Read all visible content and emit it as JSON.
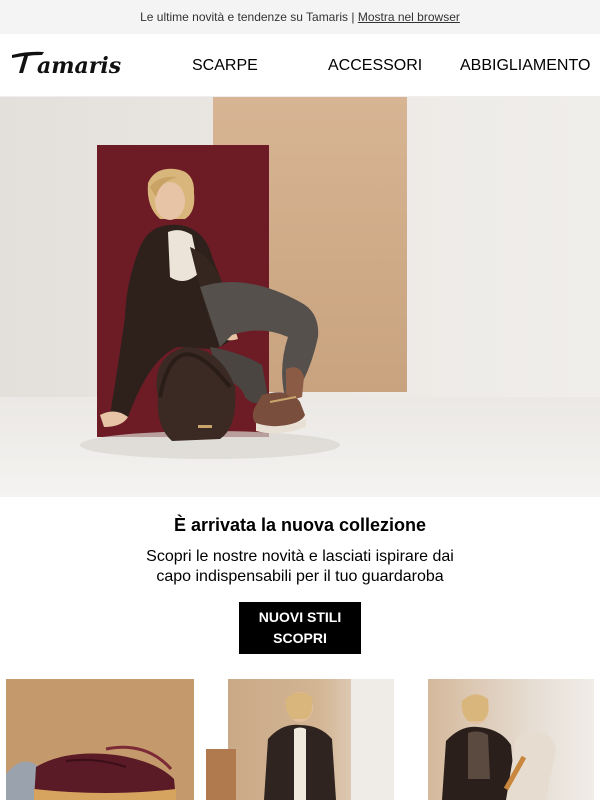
{
  "preheader": {
    "text": "Le ultime novità e tendenze su Tamaris |",
    "link": "Mostra nel browser"
  },
  "brand": {
    "logo_text": "Tamaris"
  },
  "nav": {
    "items": [
      {
        "label": "SCARPE"
      },
      {
        "label": "ACCESSORI"
      },
      {
        "label": "ABBIGLIAMENTO"
      }
    ]
  },
  "hero": {
    "alt": "Donna con giacca di pelle, jeans, borsa e sneakers"
  },
  "promo": {
    "headline": "È arrivata la nuova collezione",
    "subtext": "Scopri le nostre novità e lasciati ispirare dai capo indispensabili per il tuo guardaroba",
    "cta_label": "NUOVI STILI SCOPRI"
  },
  "colors": {
    "background": "#ffffff",
    "preheader_bg": "#f4f4f4",
    "cta_bg": "#000000",
    "cta_text": "#ffffff",
    "accent_maroon": "#6d1c26",
    "accent_tan": "#c9a37f"
  }
}
